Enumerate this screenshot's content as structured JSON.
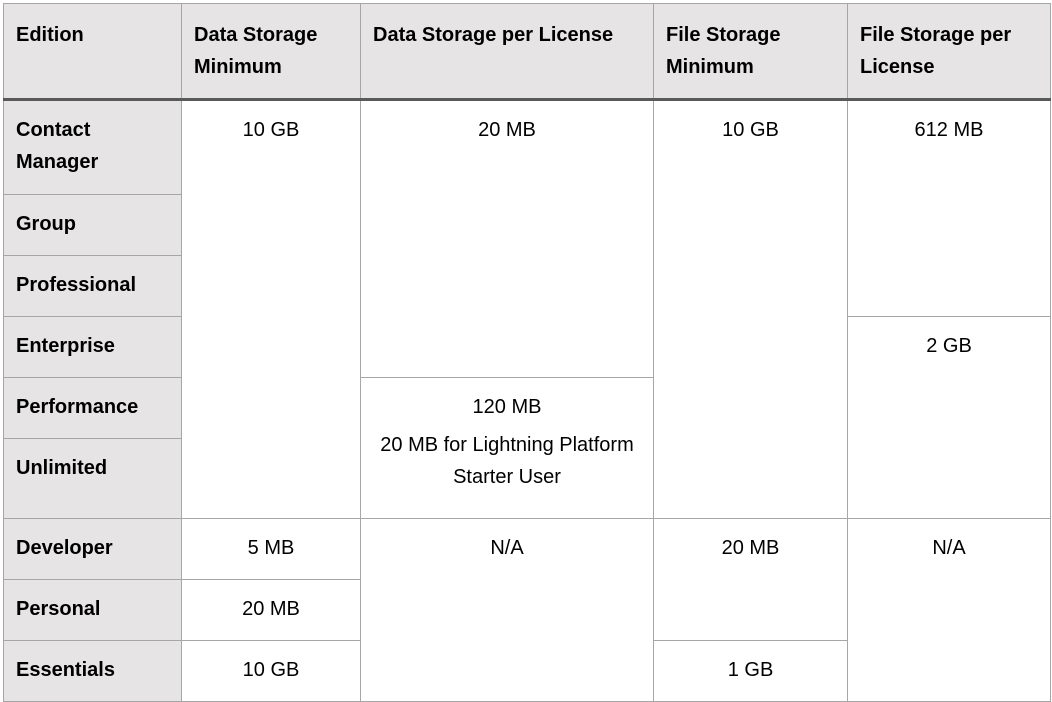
{
  "headers": [
    "Edition",
    "Data Storage Minimum",
    "Data Storage per License",
    "File Storage Minimum",
    "File Storage per License"
  ],
  "editions": [
    "Contact Manager",
    "Group",
    "Professional",
    "Enterprise",
    "Performance",
    "Unlimited",
    "Developer",
    "Personal",
    "Essentials"
  ],
  "cells": {
    "ds_min_main": "10 GB",
    "ds_lic_main": "20 MB",
    "fs_min_main": "10 GB",
    "fs_lic_main": "612 MB",
    "fs_lic_enterprise": "2 GB",
    "ds_lic_perf": "120 MB",
    "ds_lic_perf_note": "20 MB for Lightning Platform Starter User",
    "ds_min_developer": "5 MB",
    "ds_lic_developer": "N/A",
    "fs_min_developer": "20 MB",
    "fs_lic_developer": "N/A",
    "ds_min_personal": "20 MB",
    "ds_min_essentials": "10 GB",
    "fs_min_essentials": "1 GB"
  }
}
